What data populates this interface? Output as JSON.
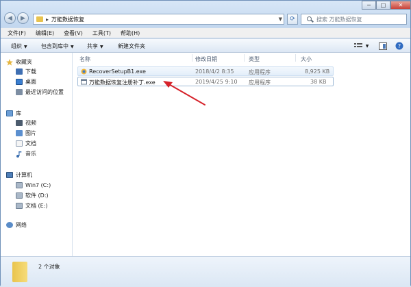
{
  "address": {
    "path": "万能数据恢复",
    "separator": "▸"
  },
  "search": {
    "placeholder": "搜索 万能数据恢复"
  },
  "window_controls": {
    "minimize": "─",
    "maximize": "□",
    "close": "✕"
  },
  "menu": [
    "文件(F)",
    "编辑(E)",
    "查看(V)",
    "工具(T)",
    "帮助(H)"
  ],
  "toolbar": {
    "organize": "组织",
    "include": "包含到库中",
    "share": "共享",
    "new_folder": "新建文件夹",
    "caret": "▼"
  },
  "nav": {
    "favorites": "收藏夹",
    "favorites_items": [
      "下载",
      "桌面",
      "最近访问的位置"
    ],
    "libraries": "库",
    "libraries_items": [
      "视频",
      "图片",
      "文档",
      "音乐"
    ],
    "computer": "计算机",
    "computer_items": [
      "Win7 (C:)",
      "软件 (D:)",
      "文档 (E:)"
    ],
    "network": "网络"
  },
  "columns": {
    "name": "名称",
    "date": "修改日期",
    "type": "类型",
    "size": "大小"
  },
  "files": [
    {
      "name": "RecoverSetupB1.exe",
      "date": "2018/4/2 8:35",
      "type": "应用程序",
      "size": "8,925 KB"
    },
    {
      "name": "万能数据恢复注册补丁.exe",
      "date": "2019/4/25 9:10",
      "type": "应用程序",
      "size": "38 KB"
    }
  ],
  "status": {
    "count": "2 个对象"
  },
  "colors": {
    "accent": "#d6222a",
    "folder": "#e8c34f"
  }
}
